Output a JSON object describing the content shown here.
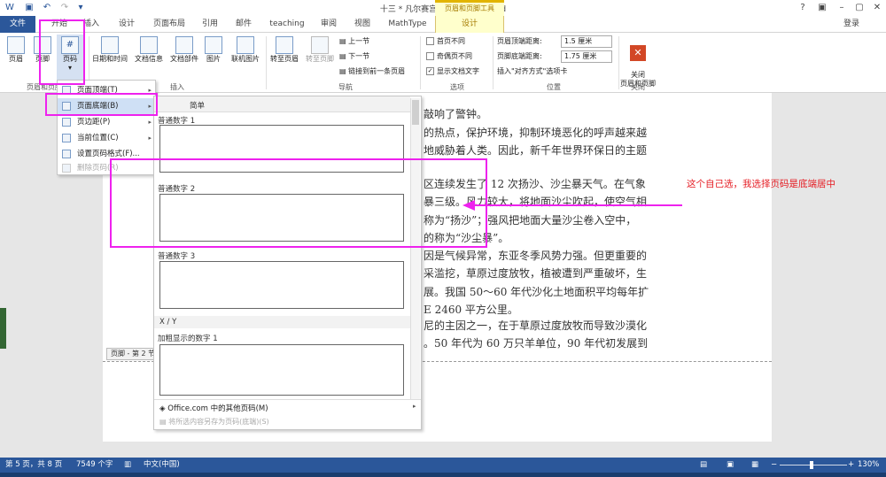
{
  "window": {
    "title": "十三 * 凡尔赛宫 [兼容模式] - Word",
    "contextual_group": "页眉和页脚工具",
    "help": "?",
    "login": "登录"
  },
  "tabs": [
    "文件",
    "开始",
    "插入",
    "设计",
    "页面布局",
    "引用",
    "邮件",
    "teaching",
    "审阅",
    "视图",
    "MathType",
    "设计"
  ],
  "ribbon": {
    "header_footer_group": {
      "label": "页眉和页脚",
      "buttons": [
        "页眉",
        "页脚",
        "页码"
      ]
    },
    "insert_group": {
      "label": "插入",
      "buttons": [
        "日期和时间",
        "文档信息",
        "文档部件",
        "图片",
        "联机图片"
      ]
    },
    "nav_group": {
      "label": "导航",
      "buttons": [
        "转至页眉",
        "转至页脚",
        "上一节",
        "下一节",
        "链接到前一条页眉"
      ]
    },
    "options_group": {
      "label": "选项",
      "items": [
        {
          "label": "首页不同",
          "checked": false
        },
        {
          "label": "奇偶页不同",
          "checked": false
        },
        {
          "label": "显示文档文字",
          "checked": true
        }
      ]
    },
    "position_group": {
      "label": "位置",
      "header_distance_label": "页眉顶端距离:",
      "header_distance_value": "1.5 厘米",
      "footer_distance_label": "页脚底端距离:",
      "footer_distance_value": "1.75 厘米",
      "insert_tab_label": "插入\"对齐方式\"选项卡"
    },
    "close_group": {
      "label": "关闭",
      "button": "关闭\n页眉和页脚"
    }
  },
  "page_number_menu": {
    "items": [
      {
        "label": "页面顶端(T)",
        "submenu": true
      },
      {
        "label": "页面底端(B)",
        "submenu": true
      },
      {
        "label": "页边距(P)",
        "submenu": true
      },
      {
        "label": "当前位置(C)",
        "submenu": true
      },
      {
        "label": "设置页码格式(F)...",
        "submenu": false
      },
      {
        "label": "删除页码(R)",
        "submenu": false
      }
    ]
  },
  "bottom_gallery": {
    "section_simple": "简单",
    "items": [
      "普通数字 1",
      "普通数字 2",
      "普通数字 3"
    ],
    "section_xy": "X / Y",
    "bold_item": "加粗显示的数字 1",
    "more": "Office.com 中的其他页码(M)",
    "save": "将所选内容另存为页码(底端)(S)"
  },
  "document": {
    "lines": [
      "敲响了警钟。",
      "的热点，保护环境，抑制环境恶化的呼声越来越",
      "地威胁着人类。因此，新千年世界环保日的主题",
      "区连续发生了 12 次扬沙、沙尘暴天气。在气象",
      "暴三级。风力较大，将地面沙尘吹起，使空气相",
      "称为“扬沙”；强风把地面大量沙尘卷入空中，",
      "的称为“沙尘暴”。",
      "因是气候异常，东亚冬季风势力强。但更重要的",
      "采滥挖，草原过度放牧，植被遭到严重破坏，生",
      "展。我国 50～60 年代沙化土地面积平均每年扩",
      "E 2460 平方公里。",
      "尼的主因之一，在于草原过度放牧而导致沙漠化",
      "。50 年代为 60 万只羊单位，90 年代初发展到"
    ],
    "footer_tag": "页脚 - 第 2 节 -"
  },
  "annotation": {
    "note": "这个自己选，我选择页码是底端居中"
  },
  "status": {
    "page": "第 5 页，共 8 页",
    "words": "7549 个字",
    "language": "中文(中国)",
    "zoom": "130%"
  },
  "colors": {
    "accent": "#2b579a",
    "contextual": "#ffffcc",
    "highlight": "#ee22ee",
    "note": "#e51c23"
  }
}
